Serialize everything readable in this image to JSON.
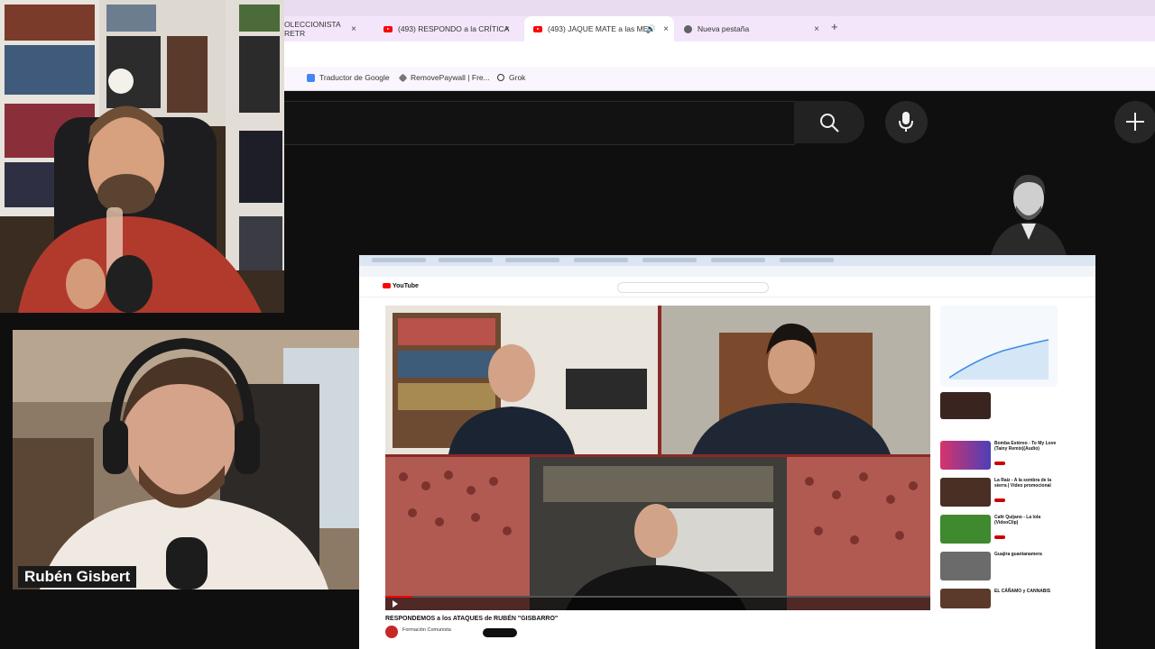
{
  "browser": {
    "tabs": [
      {
        "label": "OLECCIONISTA RETR",
        "active": false
      },
      {
        "label": "(493) RESPONDO a la CRÍTICA",
        "active": false
      },
      {
        "label": "(493) JAQUE MATE a las ME",
        "active": true
      },
      {
        "label": "Nueva pestaña",
        "active": false
      }
    ],
    "new_tab_glyph": "+",
    "close_glyph": "×",
    "bookmarks": [
      {
        "label": "Traductor de Google",
        "icon": "google-translate-icon"
      },
      {
        "label": "RemovePaywall | Fre...",
        "icon": "removepaywall-icon"
      },
      {
        "label": "Grok",
        "icon": "grok-icon"
      }
    ]
  },
  "youtube_header": {
    "icons": [
      "search-icon",
      "mic-icon",
      "plus-icon"
    ]
  },
  "webcam": {
    "host_name": "Rubén Gisbert"
  },
  "shared_screen": {
    "logo": "YouTube",
    "video_title": "RESPONDEMOS a los ATAQUES de RUBÉN \"GISBARRO\"",
    "channel": "Formación Comunista",
    "recommended": [
      {
        "title": "Bomba Estéreo - To My Love (Tainy Remix)(Audio)"
      },
      {
        "title": "La Raíz - A la sombra de la sierra | Vídeo promocional"
      },
      {
        "title": "Café Quijano - La lola (VideoClip)"
      },
      {
        "title": "Guajira guantanamera"
      },
      {
        "title": "EL CÁÑAMO y CANNABIS"
      }
    ]
  },
  "colors": {
    "tab_bar": "#f3e6fb",
    "yt_dark": "#0f0f0f",
    "youtube_red": "#ff0000",
    "video_bg": "#7a1e1e"
  }
}
